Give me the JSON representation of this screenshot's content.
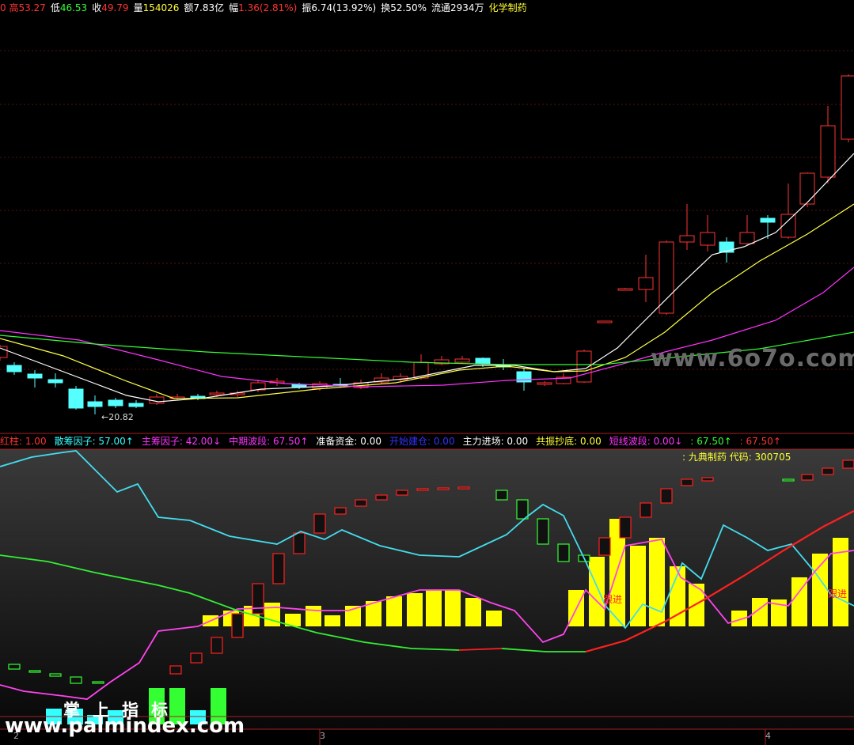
{
  "quote_bar": [
    {
      "label": "0 高",
      "value": "53.27",
      "color": "#ff3333"
    },
    {
      "label": "低",
      "value": "46.53",
      "color": "#33ff33"
    },
    {
      "label": "收",
      "value": "49.79",
      "color": "#ff3333"
    },
    {
      "label": "量",
      "value": "154026",
      "color": "#ffff33"
    },
    {
      "label": "额",
      "value": "7.83亿",
      "color": "#ffffff"
    },
    {
      "label": "幅",
      "value": "1.36(2.81%)",
      "color": "#ff3333"
    },
    {
      "label": "振",
      "value": "6.74(13.92%)",
      "color": "#ffffff"
    },
    {
      "label": "换",
      "value": "52.50%",
      "color": "#ffffff"
    },
    {
      "label": "流通",
      "value": "2934万",
      "color": "#ffffff"
    },
    {
      "label": "",
      "value": "化学制药",
      "color": "#ffff33"
    }
  ],
  "indicator_bar": [
    {
      "text": "红柱: 1.00",
      "color": "#ff3333"
    },
    {
      "text": "散筹因子: 57.00↑",
      "color": "#33ffff"
    },
    {
      "text": "主筹因子: 42.00↓",
      "color": "#ff33ff"
    },
    {
      "text": "中期波段: 67.50↑",
      "color": "#ff33ff"
    },
    {
      "text": "准备资金: 0.00",
      "color": "#ffffff"
    },
    {
      "text": "开始建仓: 0.00",
      "color": "#3333ff"
    },
    {
      "text": "主力进场: 0.00",
      "color": "#ffffff"
    },
    {
      "text": "共振抄底: 0.00",
      "color": "#ffff33"
    },
    {
      "text": "短线波段: 0.00↓",
      "color": "#ff33ff"
    },
    {
      "text": ": 67.50↑",
      "color": "#33ff33"
    },
    {
      "text": ": 67.50↑",
      "color": "#ff3333"
    }
  ],
  "stock_tag": ": 九典制药 代码: 300705",
  "low_label": "←20.82",
  "follow_label_1": "跟进",
  "follow_label_2": "跟进",
  "date_labels": [
    "2",
    "3",
    "4"
  ],
  "watermarks": {
    "site_a": "www.6o7o.com",
    "brand": "掌上指标",
    "site_b": "www.palmindex.com"
  },
  "colors": {
    "up": "#ff3333",
    "down": "#55ffff",
    "ma5": "#ffffff",
    "ma10": "#ffff44",
    "ma20": "#ff33ff",
    "ma60": "#33ff33",
    "yellow_bar": "#ffff00"
  }
}
